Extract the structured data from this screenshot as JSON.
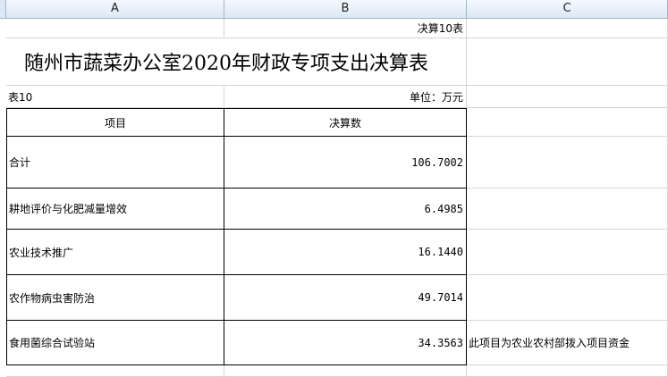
{
  "columns": [
    "A",
    "B",
    "C"
  ],
  "sheet": {
    "corner_label": "决算10表",
    "title": "随州市蔬菜办公室2020年财政专项支出决算表",
    "table_no": "表10",
    "unit": "单位：万元",
    "header": {
      "item": "项目",
      "amount": "决算数"
    },
    "rows": [
      {
        "item": "合计",
        "amount": "106.7002",
        "note": ""
      },
      {
        "item": "耕地评价与化肥减量增效",
        "amount": "6.4985",
        "note": ""
      },
      {
        "item": "农业技术推广",
        "amount": "16.1440",
        "note": ""
      },
      {
        "item": "农作物病虫害防治",
        "amount": "49.7014",
        "note": ""
      },
      {
        "item": "食用菌综合试验站",
        "amount": "34.3563",
        "note": "此项目为农业农村部拨入项目资金"
      }
    ]
  }
}
